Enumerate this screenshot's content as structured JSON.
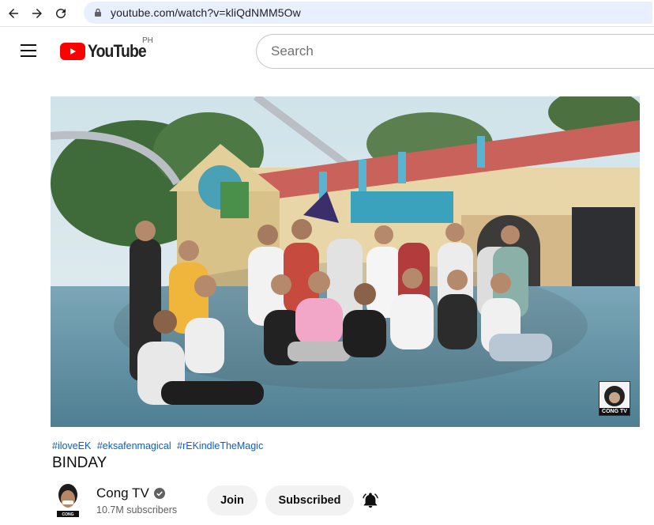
{
  "browser": {
    "url": "youtube.com/watch?v=kliQdNMM5Ow"
  },
  "header": {
    "logo_text": "YouTube",
    "country": "PH",
    "search_placeholder": "Search"
  },
  "video": {
    "watermark": "CONG TV"
  },
  "meta": {
    "hashtags": [
      "#iloveEK",
      "#eksafenmagical",
      "#rEKindleTheMagic"
    ],
    "title": "BINDAY"
  },
  "channel": {
    "name": "Cong TV",
    "subscribers": "10.7M subscribers",
    "join_label": "Join",
    "subscribed_label": "Subscribed"
  },
  "colors": {
    "brand_red": "#ff0000",
    "link_blue": "#065fd4",
    "url_bar": "#e8f0fe"
  },
  "icons": [
    "back-arrow-icon",
    "forward-arrow-icon",
    "reload-icon",
    "lock-icon",
    "hamburger-icon",
    "youtube-play-icon",
    "verified-check-icon",
    "bell-icon"
  ]
}
